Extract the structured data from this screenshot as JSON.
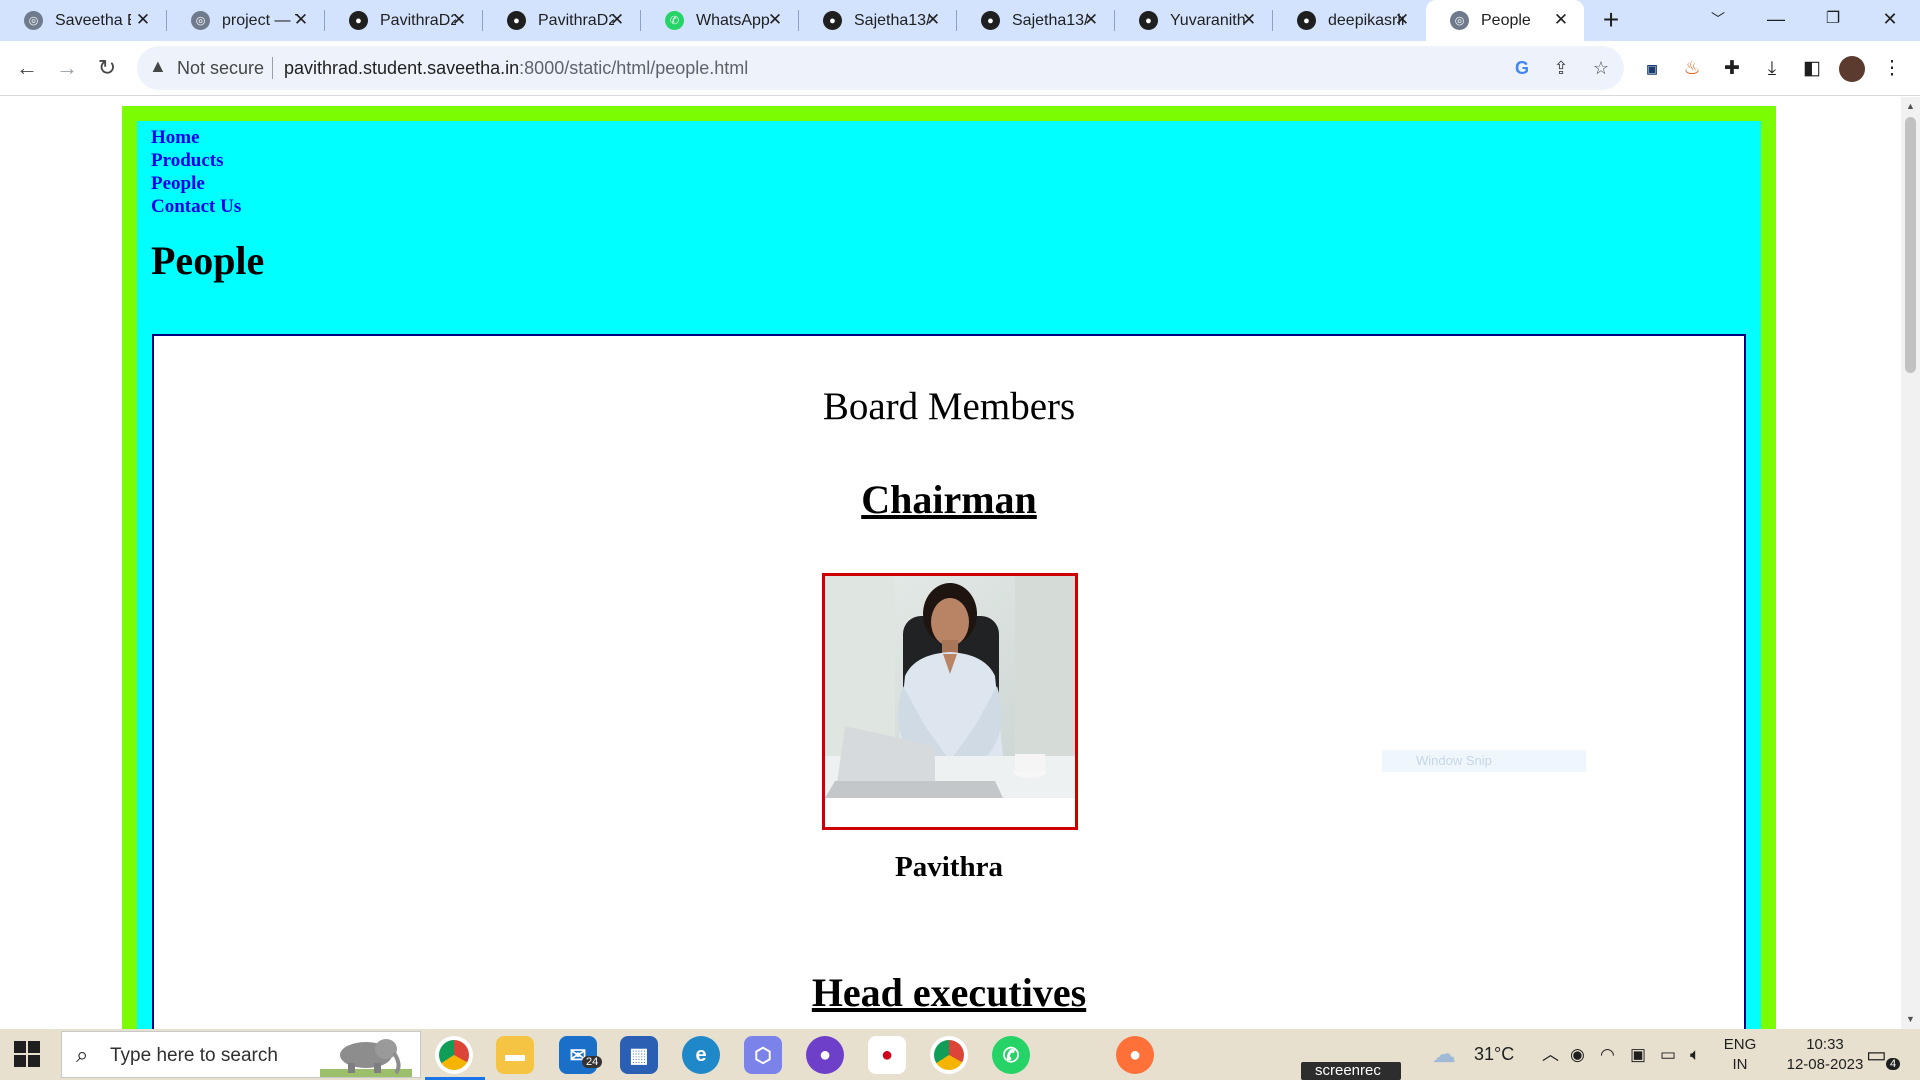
{
  "browser": {
    "tabs": [
      {
        "title": "Saveetha Engineering",
        "icon": "saveetha-globe-icon"
      },
      {
        "title": "project — Top",
        "icon": "globe-icon"
      },
      {
        "title": "PavithraD22",
        "icon": "github-icon"
      },
      {
        "title": "PavithraD22",
        "icon": "github-icon"
      },
      {
        "title": "WhatsApp",
        "icon": "whatsapp-icon"
      },
      {
        "title": "Sajetha13/p",
        "icon": "github-icon"
      },
      {
        "title": "Sajetha13/c",
        "icon": "github-icon"
      },
      {
        "title": "Yuvaranithu",
        "icon": "github-icon"
      },
      {
        "title": "deepikasrin",
        "icon": "github-icon"
      },
      {
        "title": "People",
        "icon": "globe-icon",
        "active": true
      }
    ],
    "new_tab_glyph": "+",
    "security_label": "Not secure",
    "url_host": "pavithrad.student.saveetha.in",
    "url_path": ":8000/static/html/people.html"
  },
  "page": {
    "nav_links": [
      "Home",
      "Products",
      "People",
      "Contact Us"
    ],
    "heading": "People",
    "board_title": "Board Members",
    "chairman_title": "Chairman",
    "chairman_name": "Pavithra",
    "executives_title": "Head executives",
    "overlay_text": "Window Snip",
    "colors": {
      "outer_border": "#7cfc00",
      "header_bg": "#00ffff",
      "content_border": "#000080",
      "photo_border": "#cc0000",
      "link": "#0000ee"
    }
  },
  "taskbar": {
    "search_placeholder": "Type here to search",
    "mail_badge": "24",
    "recorder_label": "screenrec",
    "weather": "31°C",
    "language": "ENG",
    "region": "IN",
    "time": "10:33",
    "date": "12-08-2023",
    "notification_count": "4"
  }
}
